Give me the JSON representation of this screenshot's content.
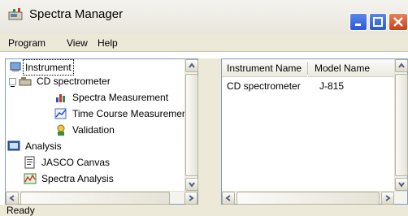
{
  "window": {
    "title": "Spectra Manager",
    "icon": "spectra-manager-icon"
  },
  "menu": {
    "items": [
      "Program",
      "View",
      "Help"
    ]
  },
  "tree": {
    "items": [
      {
        "label": "Instrument",
        "icon": "instrument-icon",
        "selected": true
      },
      {
        "label": "CD spectrometer",
        "icon": "spectrometer-icon"
      },
      {
        "label": "Spectra Measurement",
        "icon": "spectra-measurement-icon"
      },
      {
        "label": "Time Course Measurement",
        "icon": "time-course-icon"
      },
      {
        "label": "Validation",
        "icon": "validation-icon"
      },
      {
        "label": "Analysis",
        "icon": "analysis-icon"
      },
      {
        "label": "JASCO Canvas",
        "icon": "jasco-canvas-icon"
      },
      {
        "label": "Spectra Analysis",
        "icon": "spectra-analysis-icon"
      }
    ]
  },
  "table": {
    "columns": [
      "Instrument Name",
      "Model Name"
    ],
    "rows": [
      [
        "CD spectrometer",
        "J-815"
      ]
    ]
  },
  "status": {
    "text": "Ready"
  },
  "colors": {
    "selection_bg": "#316ac5",
    "window_bg": "#ece9d8",
    "title_blue": "#2a5ad6",
    "close_red": "#c7411a"
  }
}
